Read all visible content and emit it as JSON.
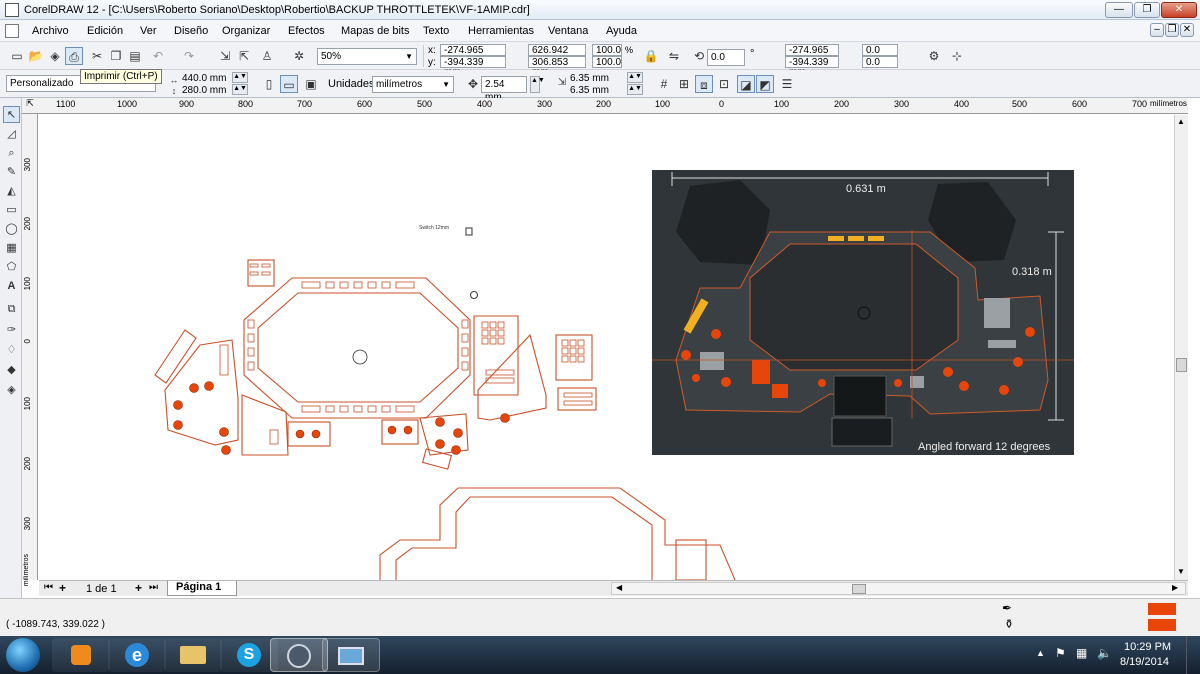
{
  "window": {
    "title": "CorelDRAW 12 - [C:\\Users\\Roberto Soriano\\Desktop\\Robertio\\BACKUP THROTTLETEK\\VF-1AMIP.cdr]",
    "minimize": "—",
    "restore": "❐",
    "close": "✕",
    "doc_min": "–",
    "doc_restore": "❐",
    "doc_close": "✕"
  },
  "menu": [
    "Archivo",
    "Edición",
    "Ver",
    "Diseño",
    "Organizar",
    "Efectos",
    "Mapas de bits",
    "Texto",
    "Herramientas",
    "Ventana",
    "Ayuda"
  ],
  "toolbar1": {
    "zoom": "50%",
    "x_label": "x:",
    "y_label": "y:",
    "x": "-274.965 mm",
    "y": "-394.339 mm",
    "w": "626.942 mm",
    "h": "306.853 mm",
    "scale_w": "100.0",
    "scale_h": "100.0",
    "pct": "%",
    "rotation": "0.0",
    "deg": "°",
    "pos_x": "-274.965 mm",
    "pos_y": "-394.339 mm",
    "skew_h": "0.0",
    "skew_v": "0.0"
  },
  "tooltip": "Imprimir (Ctrl+P)",
  "toolbar2": {
    "preset": "Personalizado",
    "page_w": "440.0 mm",
    "page_h": "280.0 mm",
    "units_label": "Unidades:",
    "units": "milímetros",
    "nudge": "2.54 mm",
    "dup_x": "6.35 mm",
    "dup_y": "6.35 mm"
  },
  "ruler_h": [
    "1100",
    "1000",
    "900",
    "800",
    "700",
    "600",
    "500",
    "400",
    "300",
    "200",
    "100",
    "0",
    "100",
    "200",
    "300",
    "400",
    "500",
    "600",
    "700"
  ],
  "ruler_unit": "milímetros",
  "ruler_v": [
    "300",
    "200",
    "100",
    "0",
    "100",
    "200",
    "300"
  ],
  "canvas": {
    "switch_label": "Switch 12mm",
    "render_dim_width": "0.631 m",
    "render_dim_height": "0.318 m",
    "render_caption": "Angled forward 12 degrees"
  },
  "pagebar": {
    "page_count": "1 de 1",
    "page_tab": "Página 1"
  },
  "status": {
    "coords": "( -1089.743, 339.022 )"
  },
  "clock": {
    "time": "10:29 PM",
    "date": "8/19/2014"
  },
  "colors": {
    "outline": "#c8512a",
    "render_bg": "#2f3538",
    "fill_swatch": "#e8450a"
  }
}
